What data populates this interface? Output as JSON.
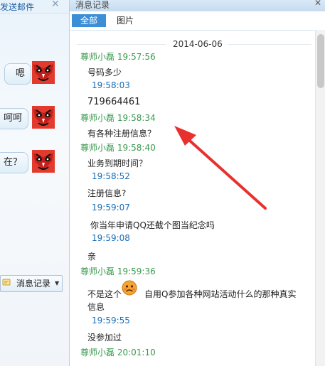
{
  "left_pane": {
    "top_text": "动发送邮件",
    "bubbles": [
      "嗯",
      "呵呵",
      "在？"
    ],
    "history_button_label": "消息记录"
  },
  "panel": {
    "title": "消息记录",
    "tabs": [
      {
        "label": "全部",
        "active": true
      },
      {
        "label": "图片",
        "active": false
      }
    ],
    "date": "2014-06-06",
    "messages": [
      {
        "type": "sender",
        "text": "尊师小磊 19:57:56"
      },
      {
        "type": "msg",
        "text": "号码多少"
      },
      {
        "type": "ts",
        "text": "19:58:03"
      },
      {
        "type": "msg",
        "text": "719664461"
      },
      {
        "type": "sender",
        "text": "尊师小磊 19:58:34"
      },
      {
        "type": "msg",
        "text": "有各种注册信息？"
      },
      {
        "type": "sender",
        "text": "尊师小磊 19:58:40"
      },
      {
        "type": "msg",
        "text": "业务到期时间？"
      },
      {
        "type": "ts",
        "text": "19:58:52"
      },
      {
        "type": "msg",
        "text": "注册信息?"
      },
      {
        "type": "ts",
        "text": "19:59:07"
      },
      {
        "type": "msg",
        "text": "你当年申请QQ还截个图当纪念吗"
      },
      {
        "type": "ts",
        "text": "19:59:08"
      },
      {
        "type": "msg",
        "text": "亲"
      },
      {
        "type": "sender",
        "text": "尊师小磊 19:59:36"
      },
      {
        "type": "msg",
        "text": "不是这个"
      },
      {
        "type": "msg",
        "text": "自用Q参加各种网站活动什么的那种真实"
      },
      {
        "type": "msg",
        "text": "信息"
      },
      {
        "type": "ts",
        "text": "19:59:55"
      },
      {
        "type": "msg",
        "text": "没参加过"
      },
      {
        "type": "sender",
        "text": "尊师小磊 20:01:10"
      }
    ]
  },
  "colors": {
    "sender": "#3a9a4f",
    "timestamp": "#1a6eb9",
    "active_tab": "#3c8fd7",
    "arrow": "#e8312e"
  },
  "icons": [
    "opera-mask-avatar-icon",
    "sad-face-emoji-icon",
    "chat-history-icon",
    "close-icon"
  ]
}
